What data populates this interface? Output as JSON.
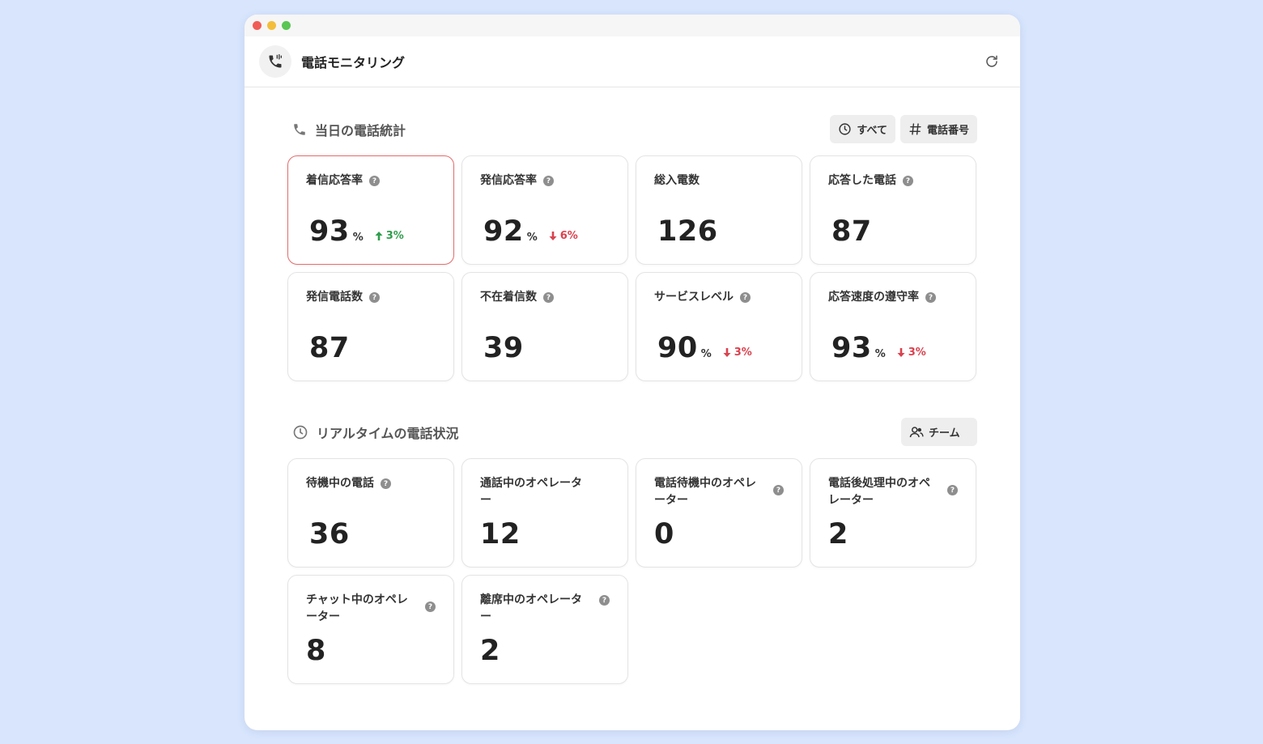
{
  "app": {
    "title": "電話モニタリング",
    "icon": "phone-icon"
  },
  "colors": {
    "background": "#d8e5fd",
    "accent_border": "#e46c6c",
    "delta_up": "#2e9e4d",
    "delta_down": "#d9424e"
  },
  "today": {
    "title": "当日の電話統計",
    "filter_all": "すべて",
    "filter_phone": "電話番号",
    "cards": [
      {
        "label": "着信応答率",
        "value": "93",
        "unit": "%",
        "delta": "3%",
        "trend": "up"
      },
      {
        "label": "発信応答率",
        "value": "92",
        "unit": "%",
        "delta": "6%",
        "trend": "down"
      },
      {
        "label": "総入電数",
        "value": "126"
      },
      {
        "label": "応答した電話",
        "value": "87"
      },
      {
        "label": "発信電話数",
        "value": "87"
      },
      {
        "label": "不在着信数",
        "value": "39"
      },
      {
        "label": "サービスレベル",
        "value": "90",
        "unit": "%",
        "delta": "3%",
        "trend": "down"
      },
      {
        "label": "応答速度の遵守率",
        "value": "93",
        "unit": "%",
        "delta": "3%",
        "trend": "down"
      }
    ]
  },
  "realtime": {
    "title": "リアルタイムの電話状況",
    "filter_team": "チーム",
    "cards": [
      {
        "label": "待機中の電話",
        "value": "36"
      },
      {
        "label": "通話中のオペレーター",
        "value": "12"
      },
      {
        "label": "電話待機中のオペレーター",
        "value": "0"
      },
      {
        "label": "電話後処理中のオペレーター",
        "value": "2"
      },
      {
        "label": "チャット中のオペレーター",
        "value": "8"
      },
      {
        "label": "離席中のオペレーター",
        "value": "2"
      }
    ]
  }
}
